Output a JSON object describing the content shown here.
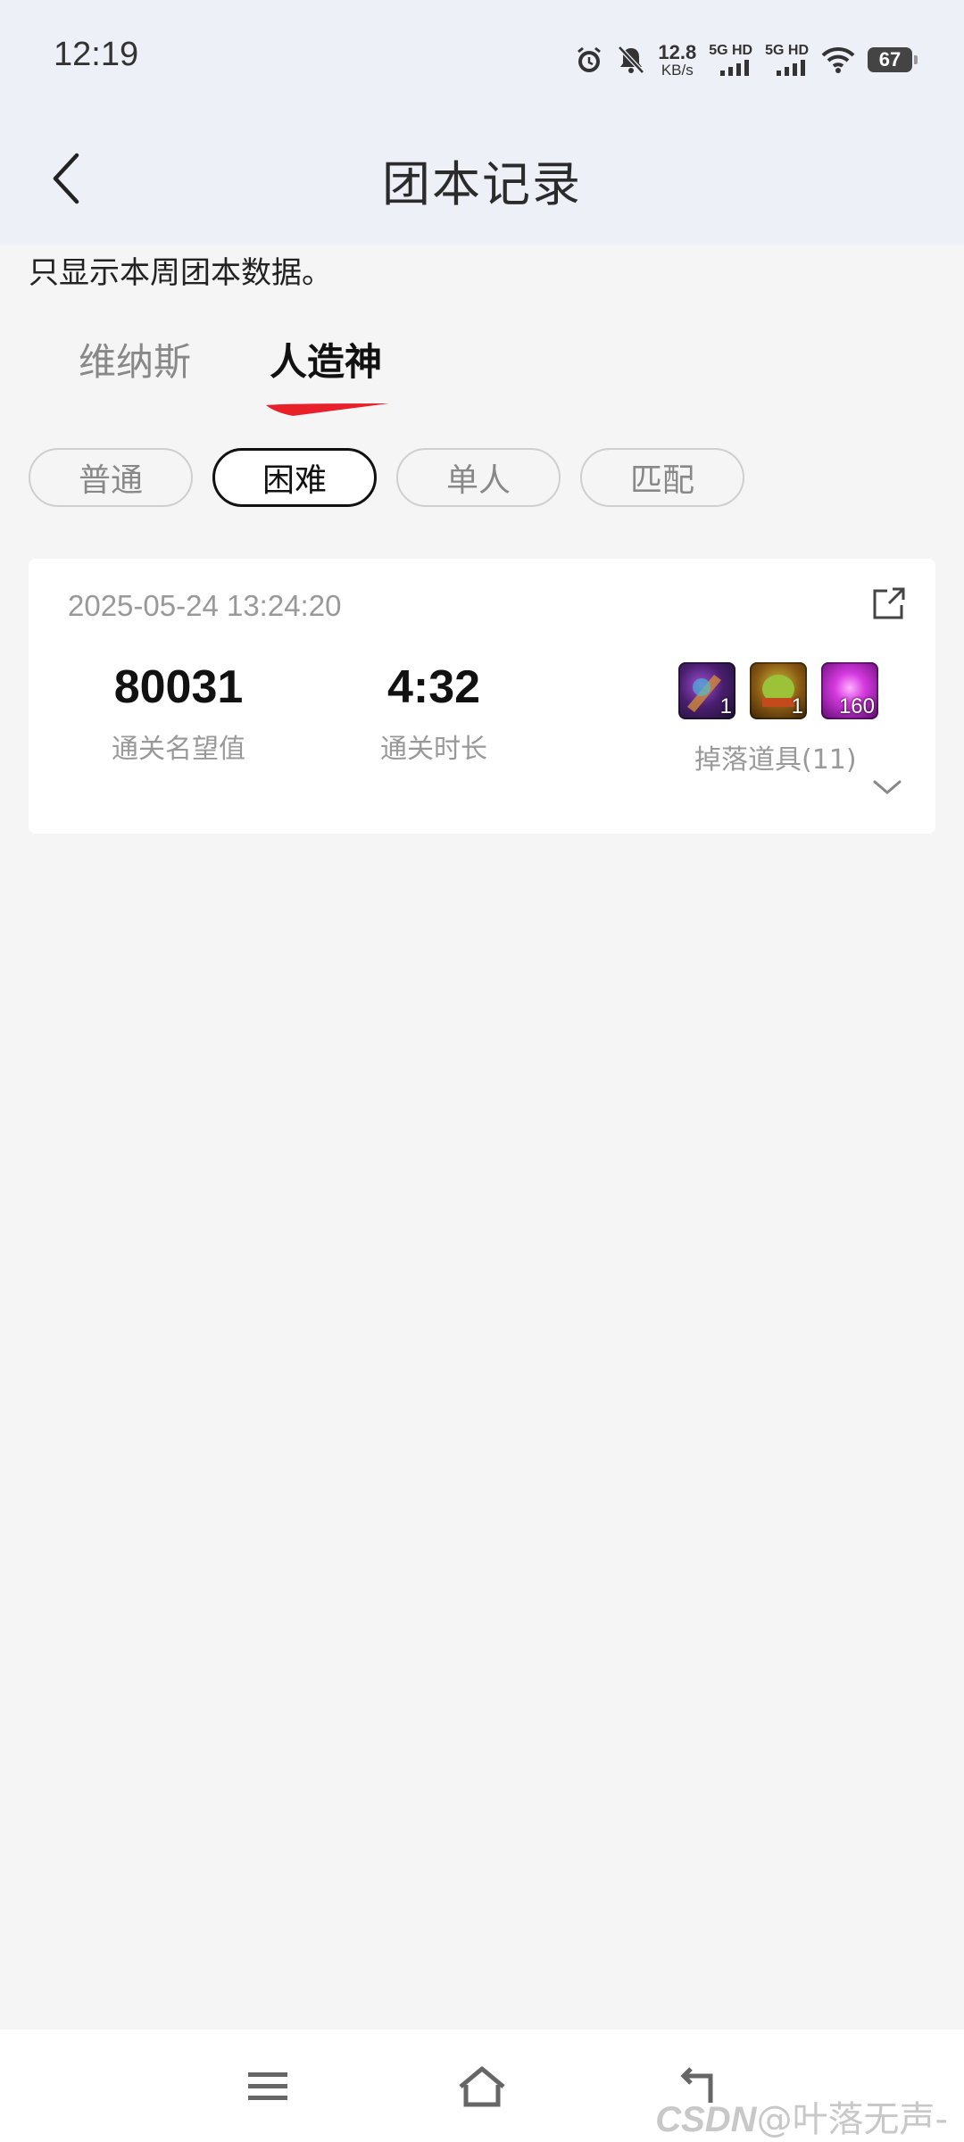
{
  "status_bar": {
    "time": "12:19",
    "net_speed_value": "12.8",
    "net_speed_unit": "KB/s",
    "signal1_label": "5G HD",
    "signal2_label": "5G HD",
    "battery": "67",
    "icons": [
      "alarm-icon",
      "mute-icon",
      "signal-icon",
      "wifi-icon",
      "battery-icon"
    ]
  },
  "header": {
    "title": "团本记录",
    "back_icon": "chevron-left-icon"
  },
  "notice": "只显示本周团本数据。",
  "tabs": [
    {
      "label": "维纳斯",
      "active": false
    },
    {
      "label": "人造神",
      "active": true
    }
  ],
  "filters": [
    {
      "label": "普通",
      "active": false
    },
    {
      "label": "困难",
      "active": true
    },
    {
      "label": "单人",
      "active": false
    },
    {
      "label": "匹配",
      "active": false
    }
  ],
  "record": {
    "datetime": "2025-05-24 13:24:20",
    "reputation_value": "80031",
    "reputation_label": "通关名望值",
    "duration_value": "4:32",
    "duration_label": "通关时长",
    "drops_label": "掉落道具(11)",
    "items": [
      {
        "icon": "purple-orb-item-icon",
        "qty": "1"
      },
      {
        "icon": "golden-helmet-item-icon",
        "qty": "1"
      },
      {
        "icon": "magenta-crystal-item-icon",
        "qty": "160"
      }
    ]
  },
  "watermark": {
    "brand": "CSDN",
    "handle": "@叶落无声-"
  },
  "colors": {
    "header_bg": "#eef0f8",
    "page_bg": "#f5f5f5",
    "accent_red": "#e8202a"
  }
}
